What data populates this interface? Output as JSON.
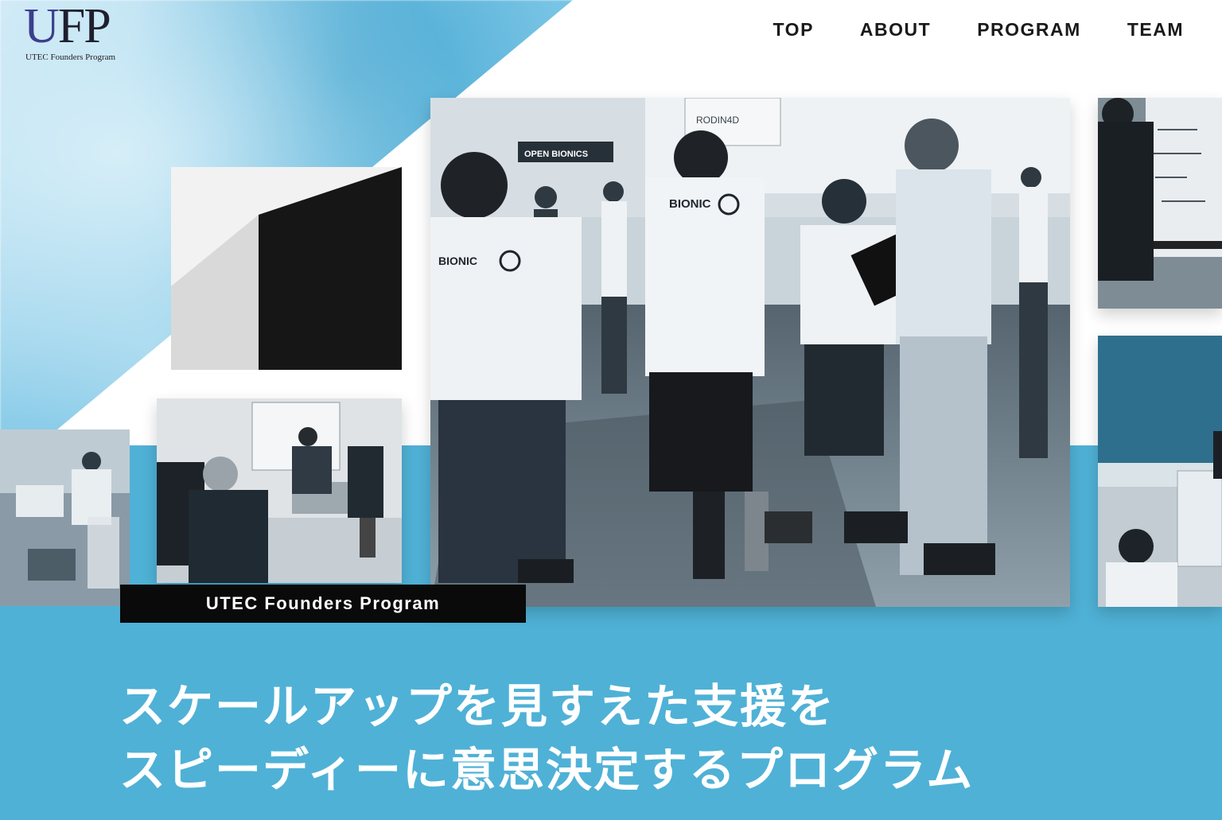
{
  "logo": {
    "mark": "UFP",
    "subtitle": "UTEC Founders Program"
  },
  "nav": {
    "items": [
      "TOP",
      "ABOUT",
      "PROGRAM",
      "TEAM"
    ]
  },
  "hero": {
    "label": "UTEC Founders Program",
    "headline_line1": "スケールアップを見すえた支援を",
    "headline_line2": "スピーディーに意思決定するプログラム"
  },
  "photo_text": {
    "shirt_brand": "BIONIC",
    "banner": "OPEN BIONICS",
    "booth_sign": "RODIN4D"
  },
  "colors": {
    "accent_blue": "#4fb1d6",
    "label_bg": "#0a0a0a",
    "nav_text": "#1a1a1a",
    "logo_u": "#3a3f8c"
  }
}
